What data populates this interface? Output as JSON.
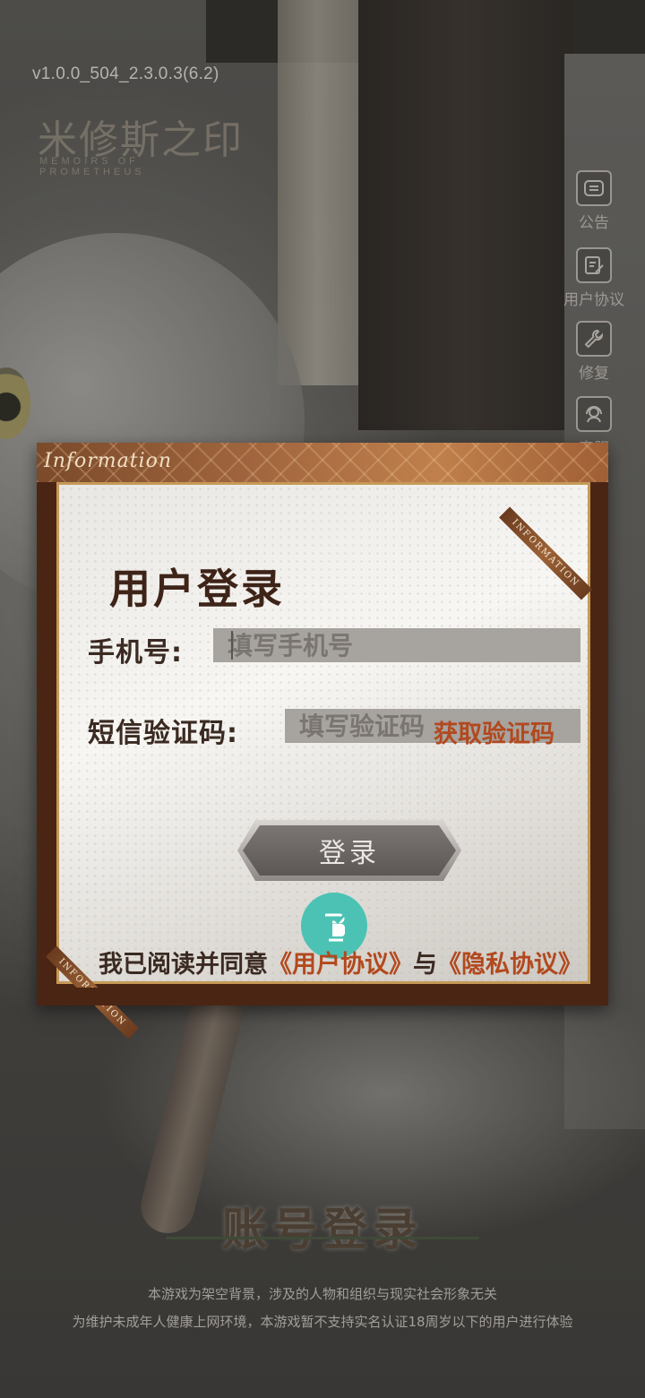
{
  "app": {
    "version": "v1.0.0_504_2.3.0.3(6.2)",
    "logo_cn": "米修斯之印",
    "logo_en": "MEMOIRS OF PROMETHEUS"
  },
  "side_menu": [
    {
      "label": "公告",
      "icon": "announcement-icon"
    },
    {
      "label": "用户协议",
      "icon": "user-agreement-icon"
    },
    {
      "label": "修复",
      "icon": "wrench-icon"
    },
    {
      "label": "客服",
      "icon": "customer-service-icon"
    }
  ],
  "dialog": {
    "header": "Information",
    "ribbon": "INFORMATION",
    "title": "用户登录",
    "phone_label": "手机号:",
    "phone_placeholder": "填写手机号",
    "code_label": "短信验证码:",
    "code_placeholder": "填写验证码",
    "get_code": "获取验证码",
    "login_button": "登录",
    "agree_prefix": "我已阅读并同意",
    "user_agreement": "《用户协议》",
    "conjunction": "与",
    "privacy_agreement": "《隐私协议》"
  },
  "footer": {
    "account_login": "账号登录",
    "disclaimer_1": "本游戏为架空背景，涉及的人物和组织与现实社会形象无关",
    "disclaimer_2": "为维护未成年人健康上网环境，本游戏暂不支持实名认证18周岁以下的用户进行体验"
  },
  "colors": {
    "accent_link": "#b2491e",
    "agree_button": "#4cc2b4",
    "dialog_frame": "#4b2514"
  }
}
